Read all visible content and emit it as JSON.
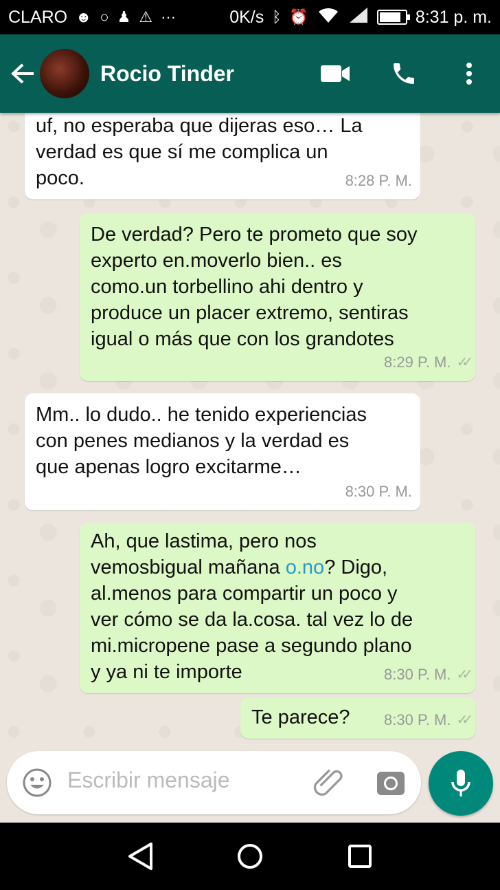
{
  "status_bar": {
    "carrier": "CLARO",
    "speed": "0K/s",
    "time": "8:31 p. m.",
    "battery_level_percent": 85
  },
  "header": {
    "contact_name": "Rocio Tinder",
    "colors": {
      "bar": "#075e54",
      "accent": "#00897b"
    }
  },
  "messages": [
    {
      "direction": "in",
      "lines": [
        "uf, no esperaba que dijeras eso… La",
        "verdad es que sí me complica un",
        "poco."
      ],
      "time": "8:28 P. M."
    },
    {
      "direction": "out",
      "lines": [
        "De verdad? Pero te prometo que soy",
        "experto en.moverlo bien.. es",
        "como.un torbellino ahi dentro y",
        "produce un placer extremo, sentiras",
        "igual o más que con los grandotes"
      ],
      "time": "8:29 P. M.",
      "ticks": "✓✓"
    },
    {
      "direction": "in",
      "lines": [
        "Mm.. lo dudo.. he tenido experiencias",
        "con penes medianos y la verdad es",
        "que apenas logro excitarme…"
      ],
      "time": "8:30 P. M."
    },
    {
      "direction": "out",
      "lines_before": [
        "Ah, que lastima, pero nos"
      ],
      "line_with_link": {
        "before": "vemosbigual mañana ",
        "link": "o.no",
        "after": "? Digo,"
      },
      "lines_after": [
        "al.menos para compartir un poco y",
        "ver cómo se da la.cosa. tal vez lo de",
        "mi.micropene pase a segundo plano",
        "y ya ni te importe"
      ],
      "time": "8:30 P. M.",
      "ticks": "✓✓"
    },
    {
      "direction": "out",
      "lines": [
        "Te parece?"
      ],
      "time": "8:30 P. M.",
      "ticks": "✓✓"
    }
  ],
  "composer": {
    "placeholder": "Escribir mensaje"
  },
  "icons": {
    "back": "arrow-left-icon",
    "video": "video-camera-icon",
    "call": "phone-icon",
    "menu": "more-vert-icon",
    "emoji": "emoji-icon",
    "attach": "paperclip-icon",
    "camera": "camera-icon",
    "mic": "microphone-icon"
  }
}
